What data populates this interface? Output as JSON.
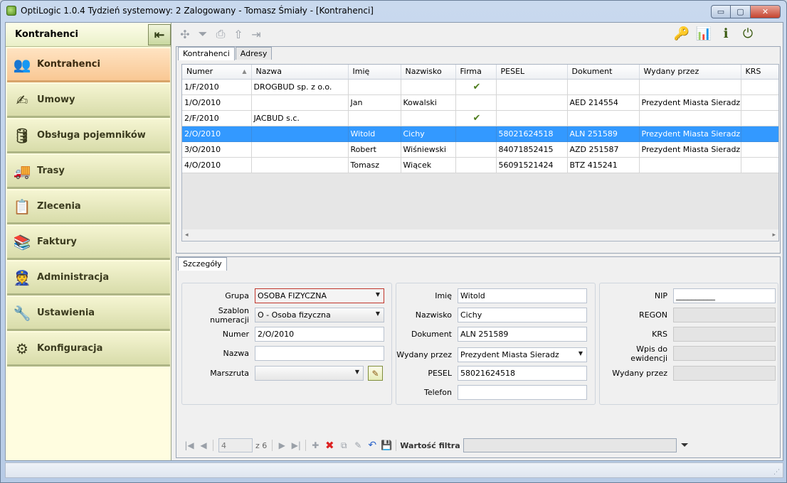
{
  "window": {
    "title": "OptiLogic 1.0.4  Tydzień systemowy: 2  Zalogowany - Tomasz Śmiały - [Kontrahenci]",
    "buttons": {
      "minimize": "▭",
      "maximize": "▢",
      "close": "✕"
    }
  },
  "sidebar": {
    "header": "Kontrahenci",
    "collapse_icon": "⇤",
    "items": [
      {
        "label": "Kontrahenci",
        "icon": "users-icon",
        "glyph": "👥",
        "active": true
      },
      {
        "label": "Umowy",
        "icon": "contract-icon",
        "glyph": "✍",
        "active": false
      },
      {
        "label": "Obsługa pojemników",
        "icon": "container-icon",
        "glyph": "🛢",
        "active": false
      },
      {
        "label": "Trasy",
        "icon": "truck-icon",
        "glyph": "🚚",
        "active": false
      },
      {
        "label": "Zlecenia",
        "icon": "order-icon",
        "glyph": "📋",
        "active": false
      },
      {
        "label": "Faktury",
        "icon": "invoice-icon",
        "glyph": "📚",
        "active": false
      },
      {
        "label": "Administracja",
        "icon": "admin-icon",
        "glyph": "👮",
        "active": false
      },
      {
        "label": "Ustawienia",
        "icon": "tools-icon",
        "glyph": "🔧",
        "active": false
      },
      {
        "label": "Konfiguracja",
        "icon": "config-gear-icon",
        "glyph": "⚙",
        "active": false
      }
    ]
  },
  "toolbar": {
    "left_icons": [
      {
        "name": "refresh-icon",
        "glyph": "✣"
      },
      {
        "name": "filter-icon",
        "glyph": "⏷"
      },
      {
        "name": "print-icon",
        "glyph": "⎙"
      },
      {
        "name": "export-icon",
        "glyph": "⇧"
      },
      {
        "name": "import-icon",
        "glyph": "⇥"
      }
    ],
    "right_icons": [
      {
        "name": "user-key-icon",
        "glyph": "🔑"
      },
      {
        "name": "stats-icon",
        "glyph": "📊"
      },
      {
        "name": "user-info-icon",
        "glyph": "ℹ"
      },
      {
        "name": "power-icon",
        "glyph": "⏻"
      }
    ]
  },
  "top_tabs": [
    {
      "label": "Kontrahenci",
      "active": true
    },
    {
      "label": "Adresy",
      "active": false
    }
  ],
  "grid": {
    "columns": [
      "Numer",
      "Nazwa",
      "Imię",
      "Nazwisko",
      "Firma",
      "PESEL",
      "Dokument",
      "Wydany przez",
      "KRS"
    ],
    "sort_icon": "▲",
    "check_glyph": "✔",
    "rows": [
      {
        "cells": [
          "1/F/2010",
          "DROGBUD sp. z o.o.",
          "",
          "",
          "",
          "",
          "",
          "",
          ""
        ],
        "firma": true,
        "selected": false
      },
      {
        "cells": [
          "1/O/2010",
          "",
          "Jan",
          "Kowalski",
          "",
          "",
          "AED 214554",
          "Prezydent Miasta Sieradz",
          ""
        ],
        "firma": false,
        "selected": false
      },
      {
        "cells": [
          "2/F/2010",
          "JACBUD s.c.",
          "",
          "",
          "",
          "",
          "",
          "",
          ""
        ],
        "firma": true,
        "selected": false
      },
      {
        "cells": [
          "2/O/2010",
          "",
          "Witold",
          "Cichy",
          "",
          "58021624518",
          "ALN 251589",
          "Prezydent Miasta Sieradz",
          ""
        ],
        "firma": false,
        "selected": true
      },
      {
        "cells": [
          "3/O/2010",
          "",
          "Robert",
          "Wiśniewski",
          "",
          "84071852415",
          "AZD 251587",
          "Prezydent Miasta Sieradz",
          ""
        ],
        "firma": false,
        "selected": false
      },
      {
        "cells": [
          "4/O/2010",
          "",
          "Tomasz",
          "Wiącek",
          "",
          "56091521424",
          "BTZ 415241",
          "",
          ""
        ],
        "firma": false,
        "selected": false
      }
    ],
    "scroll_left": "◂",
    "scroll_right": "▸"
  },
  "details_tab": "Szczegóły",
  "form": {
    "grupa": {
      "label": "Grupa",
      "value": "OSOBA FIZYCZNA"
    },
    "szablon": {
      "label": "Szablon numeracji",
      "value": "O - Osoba fizyczna"
    },
    "numer": {
      "label": "Numer",
      "value": "2/O/2010"
    },
    "nazwa": {
      "label": "Nazwa",
      "value": ""
    },
    "marszruta": {
      "label": "Marszruta",
      "value": ""
    },
    "imie": {
      "label": "Imię",
      "value": "Witold"
    },
    "nazwisko": {
      "label": "Nazwisko",
      "value": "Cichy"
    },
    "dokument": {
      "label": "Dokument",
      "value": "ALN 251589"
    },
    "wydany": {
      "label": "Wydany przez",
      "value": "Prezydent Miasta Sieradz"
    },
    "pesel": {
      "label": "PESEL",
      "value": "58021624518"
    },
    "telefon": {
      "label": "Telefon",
      "value": ""
    },
    "nip": {
      "label": "NIP",
      "value": "__________"
    },
    "regon": {
      "label": "REGON",
      "value": ""
    },
    "krs": {
      "label": "KRS",
      "value": ""
    },
    "wpis": {
      "label": "Wpis do ewidencji",
      "value": ""
    },
    "wydany2": {
      "label": "Wydany przez",
      "value": ""
    },
    "dropdown_glyph": "▼",
    "edit_glyph": "✎"
  },
  "navigator": {
    "first": "|◀",
    "prev": "◀",
    "position": "4",
    "total": "z 6",
    "next": "▶",
    "last": "▶|",
    "add": "✚",
    "delete": "✖",
    "copy": "⧉",
    "edit": "✎",
    "undo": "↶",
    "save": "💾",
    "filter_label": "Wartość filtra",
    "filter_value": "",
    "filter_icon": "⏷"
  },
  "status": {
    "grip": "⋰"
  }
}
